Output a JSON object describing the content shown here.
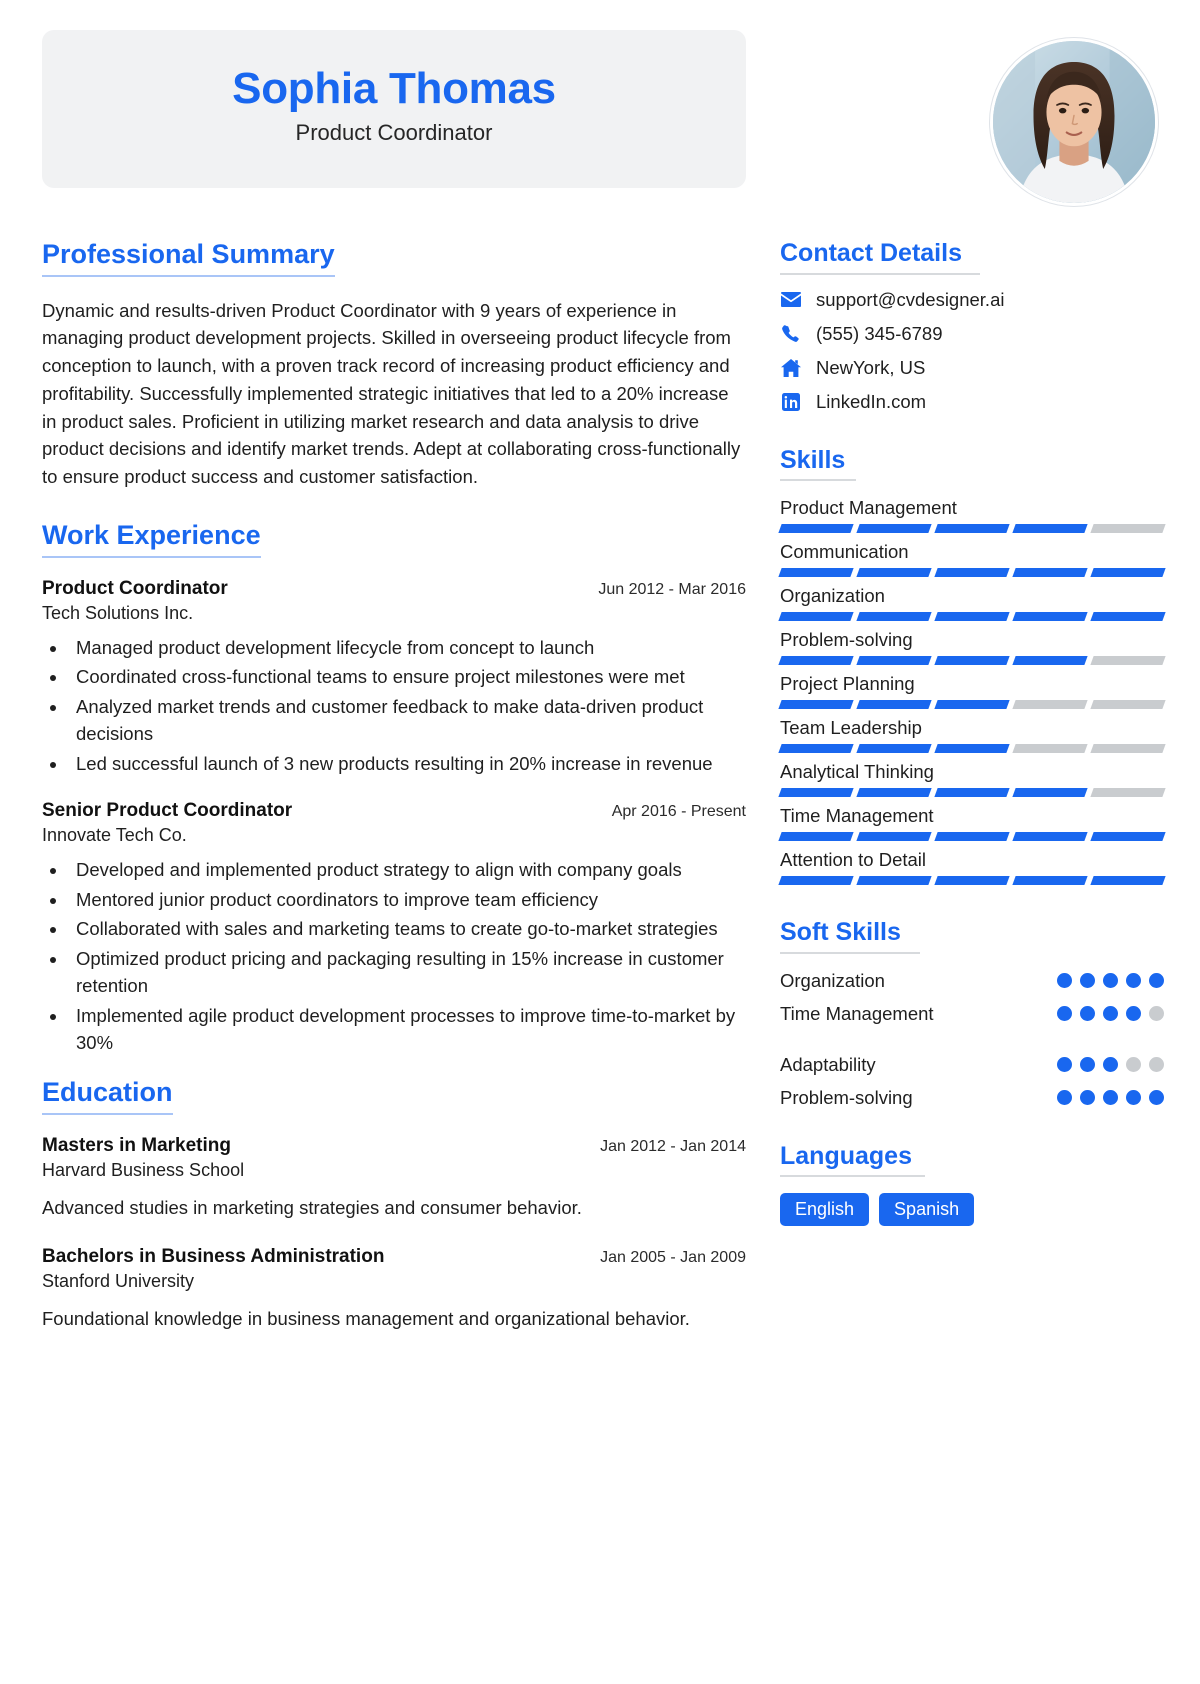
{
  "header": {
    "full_name": "Sophia Thomas",
    "job_title": "Product Coordinator",
    "avatar_alt": "profile-photo"
  },
  "colors": {
    "accent": "#1967ef",
    "bar_empty": "#c9cccf",
    "header_bg": "#f1f2f3",
    "text": "#1f1f1f"
  },
  "summary": {
    "heading": "Professional Summary",
    "text": "Dynamic and results-driven Product Coordinator with 9 years of experience in managing product development projects. Skilled in overseeing product lifecycle from conception to launch, with a proven track record of increasing product efficiency and profitability. Successfully implemented strategic initiatives that led to a 20% increase in product sales. Proficient in utilizing market research and data analysis to drive product decisions and identify market trends. Adept at collaborating cross-functionally to ensure product success and customer satisfaction."
  },
  "work_experience": {
    "heading": "Work Experience",
    "entries": [
      {
        "role": "Product Coordinator",
        "date": "Jun 2012 - Mar 2016",
        "organization": "Tech Solutions Inc.",
        "bullets": [
          "Managed product development lifecycle from concept to launch",
          "Coordinated cross-functional teams to ensure project milestones were met",
          "Analyzed market trends and customer feedback to make data-driven product decisions",
          "Led successful launch of 3 new products resulting in 20% increase in revenue"
        ]
      },
      {
        "role": "Senior Product Coordinator",
        "date": "Apr 2016 - Present",
        "organization": "Innovate Tech Co.",
        "bullets": [
          "Developed and implemented product strategy to align with company goals",
          "Mentored junior product coordinators to improve team efficiency",
          "Collaborated with sales and marketing teams to create go-to-market strategies",
          "Optimized product pricing and packaging resulting in 15% increase in customer retention",
          "Implemented agile product development processes to improve time-to-market by 30%"
        ]
      }
    ]
  },
  "education": {
    "heading": "Education",
    "entries": [
      {
        "degree": "Masters in Marketing",
        "date": "Jan 2012 - Jan 2014",
        "school": "Harvard Business School",
        "description": "Advanced studies in marketing strategies and consumer behavior."
      },
      {
        "degree": "Bachelors in Business Administration",
        "date": "Jan 2005 - Jan 2009",
        "school": "Stanford University",
        "description": "Foundational knowledge in business management and organizational behavior."
      }
    ]
  },
  "contact": {
    "heading": "Contact Details",
    "items": [
      {
        "icon": "email-icon",
        "value": "support@cvdesigner.ai"
      },
      {
        "icon": "phone-icon",
        "value": "(555) 345-6789"
      },
      {
        "icon": "home-icon",
        "value": "NewYork, US"
      },
      {
        "icon": "linkedin-icon",
        "value": "LinkedIn.com"
      }
    ]
  },
  "skills": {
    "heading": "Skills",
    "max_level": 5,
    "items": [
      {
        "name": "Product Management",
        "level": 4
      },
      {
        "name": "Communication",
        "level": 5
      },
      {
        "name": "Organization",
        "level": 5
      },
      {
        "name": "Problem-solving",
        "level": 4
      },
      {
        "name": "Project Planning",
        "level": 3
      },
      {
        "name": "Team Leadership",
        "level": 3
      },
      {
        "name": "Analytical Thinking",
        "level": 4
      },
      {
        "name": "Time Management",
        "level": 5
      },
      {
        "name": "Attention to Detail",
        "level": 5
      }
    ]
  },
  "soft_skills": {
    "heading": "Soft Skills",
    "max_level": 5,
    "groups": [
      [
        {
          "name": "Organization",
          "level": 5
        },
        {
          "name": "Time Management",
          "level": 4
        }
      ],
      [
        {
          "name": "Adaptability",
          "level": 3
        },
        {
          "name": "Problem-solving",
          "level": 5
        }
      ]
    ]
  },
  "languages": {
    "heading": "Languages",
    "items": [
      "English",
      "Spanish"
    ]
  }
}
